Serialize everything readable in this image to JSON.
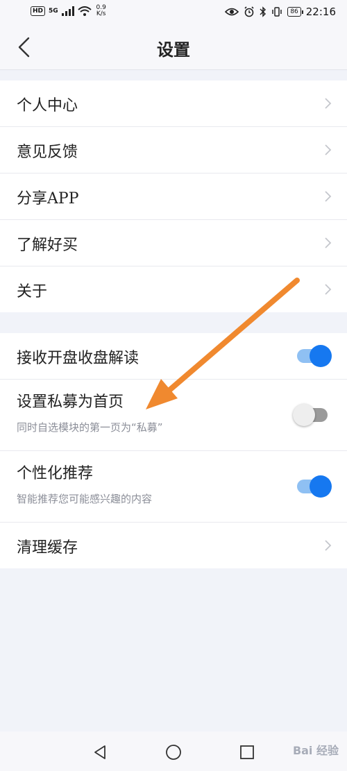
{
  "status_bar": {
    "hd_badge": "HD",
    "network": "5G",
    "net_speed_value": "0.9",
    "net_speed_unit": "K/s",
    "battery": "86",
    "time": "22:16"
  },
  "header": {
    "title": "设置",
    "back_icon": "chevron-left-icon"
  },
  "group1": {
    "items": [
      {
        "label": "个人中心"
      },
      {
        "label": "意见反馈"
      },
      {
        "label": "分享APP"
      },
      {
        "label": "了解好买"
      },
      {
        "label": "关于"
      }
    ]
  },
  "group2": {
    "items": [
      {
        "label": "接收开盘收盘解读",
        "toggle": true
      },
      {
        "label": "设置私募为首页",
        "subtitle": "同时自选模块的第一页为“私募”",
        "toggle": false
      },
      {
        "label": "个性化推荐",
        "subtitle": "智能推荐您可能感兴趣的内容",
        "toggle": true
      },
      {
        "label": "清理缓存"
      }
    ]
  },
  "system_nav": {
    "back_icon": "triangle-back-icon",
    "home_icon": "circle-home-icon",
    "recents_icon": "square-recents-icon"
  },
  "watermark": "Bai 经验",
  "colors": {
    "toggle_on": "#1678f0",
    "toggle_on_track": "#8fc0f3",
    "annotation_arrow": "#f0892f",
    "page_bg": "#f1f3f9"
  }
}
